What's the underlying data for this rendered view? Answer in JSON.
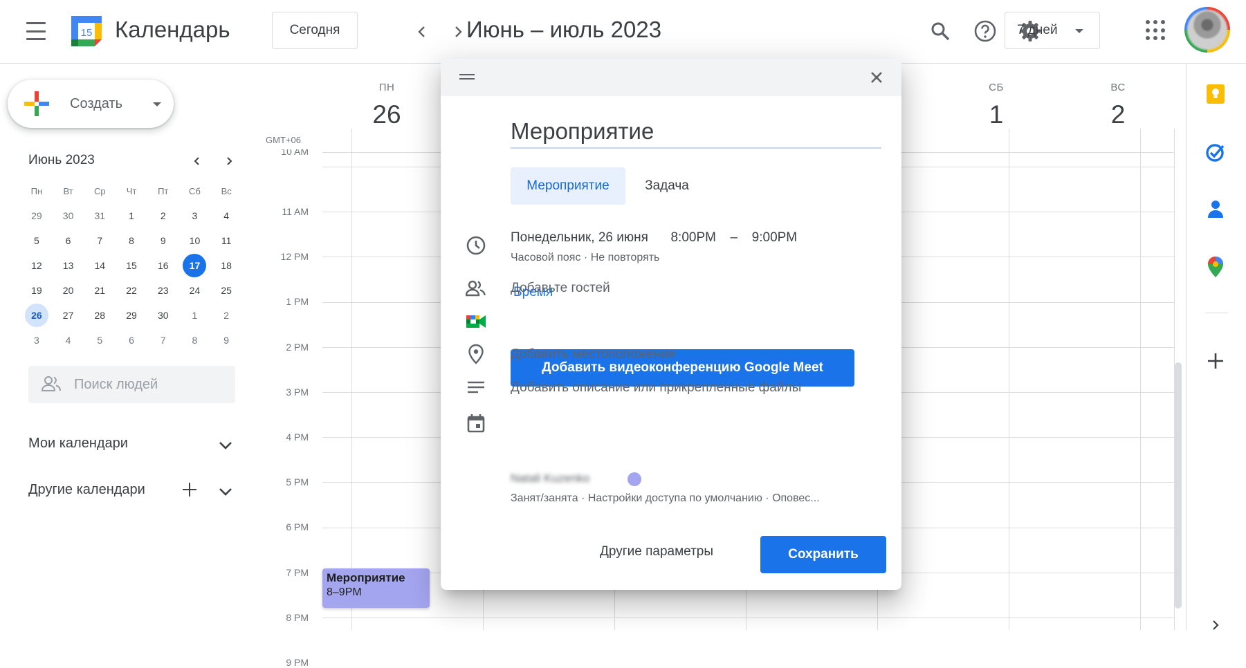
{
  "header": {
    "app_title": "Календарь",
    "logo_day": "15",
    "today_label": "Сегодня",
    "date_range": "Июнь – июль 2023",
    "view_label": "7 дней"
  },
  "sidebar": {
    "create_label": "Создать",
    "mini_month": "Июнь 2023",
    "dow": [
      "Пн",
      "Вт",
      "Ср",
      "Чт",
      "Пт",
      "Сб",
      "Вс"
    ],
    "weeks": [
      [
        "29",
        "30",
        "31",
        "1",
        "2",
        "3",
        "4"
      ],
      [
        "5",
        "6",
        "7",
        "8",
        "9",
        "10",
        "11"
      ],
      [
        "12",
        "13",
        "14",
        "15",
        "16",
        "17",
        "18"
      ],
      [
        "19",
        "20",
        "21",
        "22",
        "23",
        "24",
        "25"
      ],
      [
        "26",
        "27",
        "28",
        "29",
        "30",
        "1",
        "2"
      ],
      [
        "3",
        "4",
        "5",
        "6",
        "7",
        "8",
        "9"
      ]
    ],
    "today": "17",
    "selected": "26",
    "people_search_placeholder": "Поиск людей",
    "my_calendars": "Мои календари",
    "other_calendars": "Другие календари"
  },
  "grid": {
    "timezone": "GMT+06",
    "days": [
      {
        "dow": "ПН",
        "num": "26"
      },
      {
        "dow": "СБ",
        "num": "1"
      },
      {
        "dow": "ВС",
        "num": "2"
      }
    ],
    "partial_top_label": "10 AM",
    "times": [
      "11 AM",
      "12 PM",
      "1 PM",
      "2 PM",
      "3 PM",
      "4 PM",
      "5 PM",
      "6 PM",
      "7 PM",
      "8 PM",
      "9 PM"
    ],
    "event": {
      "title": "Мероприятие",
      "time": "8–9PM"
    }
  },
  "dialog": {
    "title_value": "Мероприятие",
    "tab_event": "Мероприятие",
    "tab_task": "Задача",
    "date": "Понедельник, 26 июня",
    "start_time": "8:00PM",
    "dash": "–",
    "end_time": "9:00PM",
    "time_sub": "Часовой пояс · Не повторять",
    "time_link": "Время",
    "add_guests": "Добавьте гостей",
    "meet_button": "Добавить видеоконференцию Google Meet",
    "add_location": "Добавить местоположение",
    "add_description": "Добавить описание или прикрепленные файлы",
    "owner_name": "Natali Kuzenko",
    "owner_sub": "Занят/занята · Настройки доступа по умолчанию · Оповес...",
    "more_options": "Другие параметры",
    "save": "Сохранить"
  },
  "colors": {
    "accent": "#1a73e8",
    "event": "#a4a5ef",
    "tab_bg": "#e8f0fe"
  }
}
